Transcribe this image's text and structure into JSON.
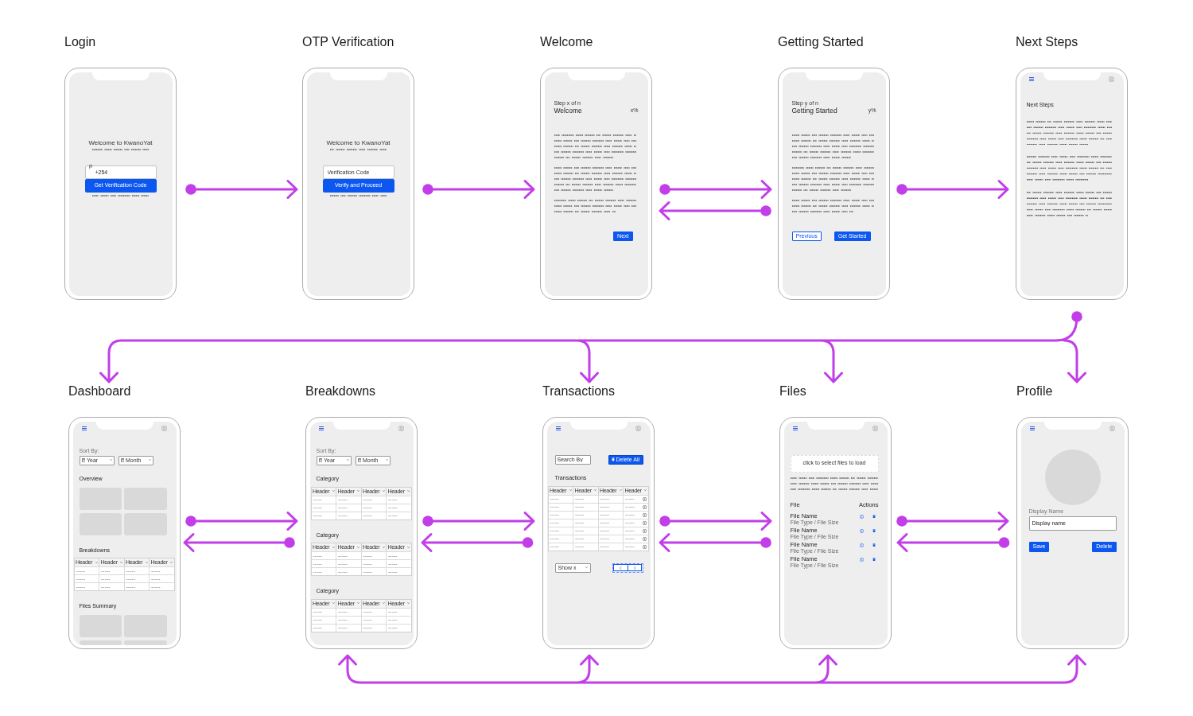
{
  "rows": [
    {
      "screens": [
        {
          "title": "Login",
          "kind": "login",
          "heading": "Welcome to KwanoYat",
          "field": {
            "value": "+254"
          },
          "button": "Get Verification Code"
        },
        {
          "title": "OTP Verification",
          "kind": "otp",
          "heading": "Welcome to KwanoYat",
          "field": {
            "placeholder": "Verification Code"
          },
          "button": "Verify and Proceed"
        },
        {
          "title": "Welcome",
          "kind": "step",
          "step": "Step x of n",
          "heading": "Welcome",
          "progress": "x%",
          "buttons": [
            {
              "label": "Next",
              "kind": "primary"
            }
          ]
        },
        {
          "title": "Getting Started",
          "kind": "step",
          "step": "Step y of n",
          "heading": "Getting Started",
          "progress": "y%",
          "buttons": [
            {
              "label": "Previous",
              "kind": "outline"
            },
            {
              "label": "Get Started",
              "kind": "primary"
            }
          ]
        },
        {
          "title": "Next Steps",
          "kind": "article",
          "heading": "Next Steps"
        }
      ],
      "arrows": [
        {
          "kind": "forward"
        },
        {
          "kind": "forward"
        },
        {
          "kind": "pair"
        },
        {
          "kind": "forward"
        }
      ]
    },
    {
      "screens": [
        {
          "title": "Dashboard",
          "kind": "dashboard",
          "branch_target": true,
          "bus_target": false,
          "sort_label": "Sort By:",
          "filters": [
            "Year",
            "Month"
          ],
          "sections": [
            {
              "kind": "tiles",
              "heading": "Overview"
            },
            {
              "kind": "table",
              "heading": "Breakdowns",
              "table": {
                "columns": [
                  "Header",
                  "Header",
                  "Header",
                  "Header"
                ],
                "rows": [
                  [
                    "-----",
                    "-----",
                    "-----",
                    "-----"
                  ],
                  [
                    "-----",
                    "-----",
                    "-----",
                    "-----"
                  ],
                  [
                    "-----",
                    "-----",
                    "-----",
                    "-----"
                  ]
                ]
              }
            },
            {
              "kind": "tiles",
              "heading": "Files Summary"
            }
          ]
        },
        {
          "title": "Breakdowns",
          "kind": "dashboard",
          "branch_target": false,
          "bus_target": true,
          "sort_label": "Sort By:",
          "filters": [
            "Year",
            "Month"
          ],
          "sections": [
            {
              "kind": "table",
              "heading": "Category",
              "table": {
                "columns": [
                  "Header",
                  "Header",
                  "Header",
                  "Header"
                ],
                "rows": [
                  [
                    "-----",
                    "-----",
                    "-----",
                    "-----"
                  ],
                  [
                    "-----",
                    "-----",
                    "-----",
                    "-----"
                  ],
                  [
                    "-----",
                    "-----",
                    "-----",
                    "-----"
                  ]
                ]
              }
            },
            {
              "kind": "table",
              "heading": "Category",
              "table": {
                "columns": [
                  "Header",
                  "Header",
                  "Header",
                  "Header"
                ],
                "rows": [
                  [
                    "-----",
                    "-----",
                    "-----",
                    "-----"
                  ],
                  [
                    "-----",
                    "-----",
                    "-----",
                    "-----"
                  ],
                  [
                    "-----",
                    "-----",
                    "-----",
                    "-----"
                  ]
                ]
              }
            },
            {
              "kind": "table",
              "heading": "Category",
              "table": {
                "columns": [
                  "Header",
                  "Header",
                  "Header",
                  "Header"
                ],
                "rows": [
                  [
                    "-----",
                    "-----",
                    "-----",
                    "-----"
                  ],
                  [
                    "-----",
                    "-----",
                    "-----",
                    "-----"
                  ],
                  [
                    "-----",
                    "-----",
                    "-----",
                    "-----"
                  ]
                ]
              }
            }
          ]
        },
        {
          "title": "Transactions",
          "kind": "transactions",
          "branch_target": true,
          "bus_target": true,
          "search": {
            "placeholder": "Search By"
          },
          "action": "Delete All",
          "heading": "Transactions",
          "table": {
            "columns": [
              "Header",
              "Header",
              "Header",
              "Header"
            ],
            "rows": [
              [
                "-----",
                "-----",
                "-----",
                "-----"
              ],
              [
                "-----",
                "-----",
                "-----",
                "-----"
              ],
              [
                "-----",
                "-----",
                "-----",
                "-----"
              ],
              [
                "-----",
                "-----",
                "-----",
                "-----"
              ],
              [
                "-----",
                "-----",
                "-----",
                "-----"
              ],
              [
                "-----",
                "-----",
                "-----",
                "-----"
              ],
              [
                "-----",
                "-----",
                "-----",
                "-----"
              ]
            ]
          },
          "page_size": "Show x"
        },
        {
          "title": "Files",
          "kind": "files",
          "branch_target": true,
          "bus_target": true,
          "upload": "click to select files to load",
          "columns": [
            "File",
            "Actions"
          ],
          "files": [
            {
              "name": "File Name",
              "meta": "File Type / File Size"
            },
            {
              "name": "File Name",
              "meta": "File Type / File Size"
            },
            {
              "name": "File Name",
              "meta": "File Type / File Size"
            },
            {
              "name": "File Name",
              "meta": "File Type / File Size"
            }
          ]
        },
        {
          "title": "Profile",
          "kind": "profile",
          "branch_target": true,
          "bus_target": true,
          "field_label": "Display Name",
          "field": {
            "value": "Display name"
          },
          "buttons": [
            {
              "label": "Save",
              "kind": "primary"
            },
            {
              "label": "Delete",
              "kind": "primary"
            }
          ]
        }
      ],
      "arrows": [
        {
          "kind": "pair"
        },
        {
          "kind": "pair"
        },
        {
          "kind": "pair"
        },
        {
          "kind": "pair"
        }
      ]
    }
  ]
}
